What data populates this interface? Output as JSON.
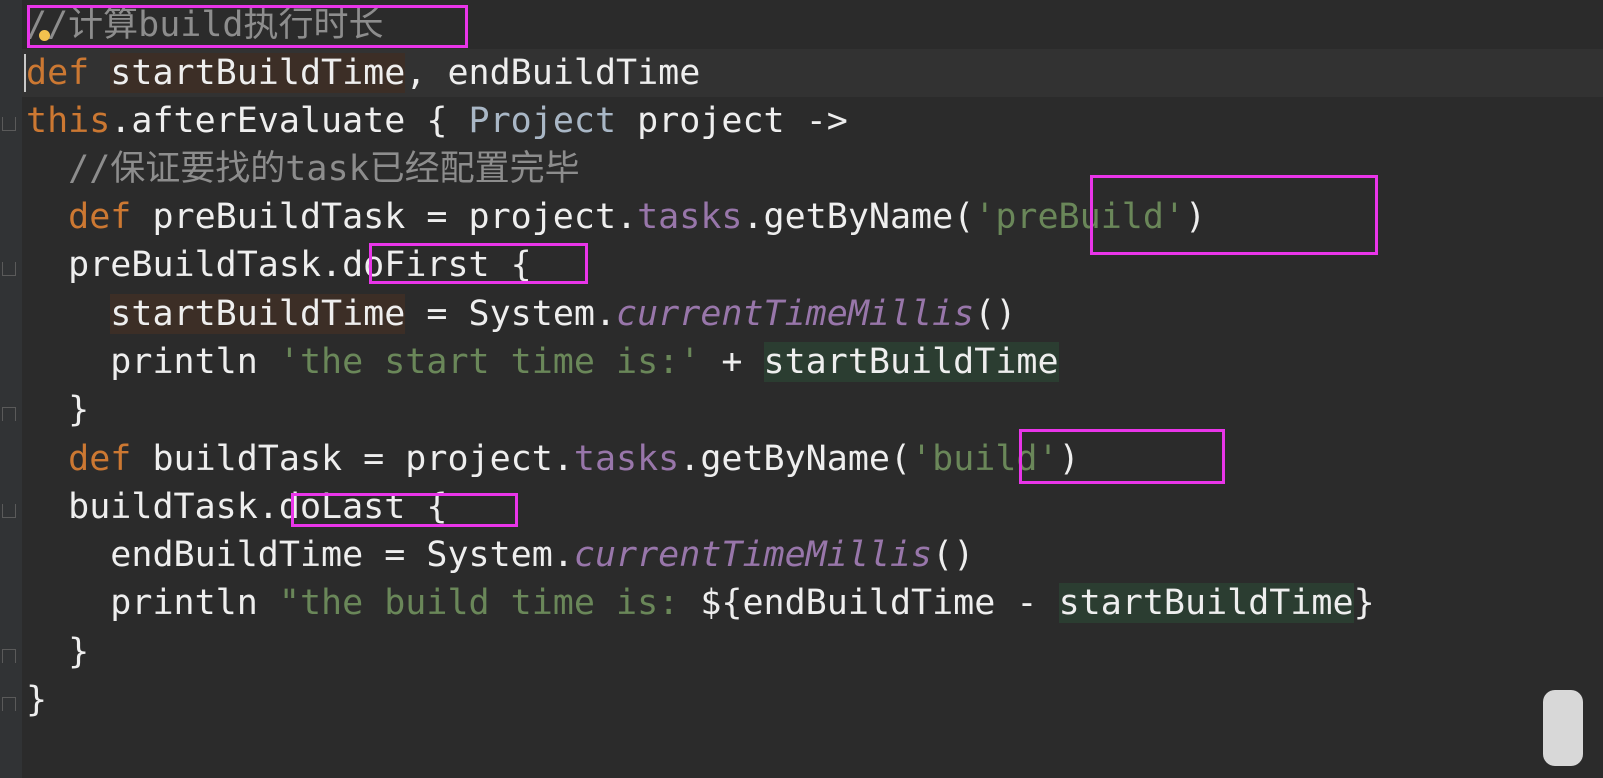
{
  "editor": {
    "colors": {
      "background": "#2b2b2b",
      "comment": "#8d8d8d",
      "keyword": "#cc7832",
      "field": "#9876aa",
      "string": "#6a8759",
      "annotation_box": "#e935e9"
    },
    "lines": [
      {
        "comment": "//计算build执行时长"
      },
      {
        "kw": "def",
        "var1": "startBuildTime",
        "sep": ", ",
        "var2": "endBuildTime"
      },
      {
        "recv": "this",
        "dot": ".",
        "method": "afterEvaluate",
        "brace": " { ",
        "type": "Project",
        "param": " project ",
        "arrow": "->"
      },
      {
        "comment": "//保证要找的task已经配置完毕"
      },
      {
        "kw": "def",
        "name": " preBuildTask = project.",
        "field": "tasks",
        "call": ".getByName",
        "open": "(",
        "str": "'preBuild'",
        "close": ")"
      },
      {
        "name": "preBuildTask",
        "method": ".doFirst",
        "brace": " {"
      },
      {
        "var": "startBuildTime",
        "assign": " = System.",
        "call": "currentTimeMillis",
        "parens": "()"
      },
      {
        "fn": "println ",
        "str": "'the start time is:'",
        "plus": " + ",
        "var": "startBuildTime"
      },
      {
        "brace": "}"
      },
      {
        "kw": "def",
        "name": " buildTask = project.",
        "field": "tasks",
        "call": ".getByName",
        "open": "(",
        "str": "'build'",
        "close": ")"
      },
      {
        "name": "buildTask",
        "method": ".doLast",
        "brace": " {"
      },
      {
        "var": "endBuildTime",
        "assign": " = System.",
        "call": "currentTimeMillis",
        "parens": "()"
      },
      {
        "fn": "println ",
        "str": "\"the build time is: ",
        "expr_open": "${",
        "var1": "endBuildTime",
        "minus": " - ",
        "var2": "startBuildTime",
        "expr_close": "}"
      },
      {
        "brace": "}"
      },
      {
        "brace": "}"
      }
    ]
  }
}
